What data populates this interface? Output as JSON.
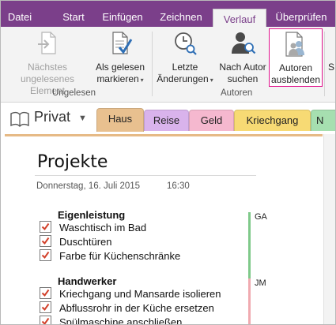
{
  "ribbon_tabs": [
    "Datei",
    "Start",
    "Einfügen",
    "Zeichnen",
    "Verlauf",
    "Überprüfen"
  ],
  "active_tab": "Verlauf",
  "ribbon": {
    "next_unread": {
      "line1": "Nächstes",
      "line2": "ungelesenes Element"
    },
    "mark_read": {
      "line1": "Als gelesen",
      "line2": "markieren"
    },
    "recent_changes": {
      "line1": "Letzte",
      "line2": "Änderungen"
    },
    "find_by_author": {
      "line1": "Nach Autor",
      "line2": "suchen"
    },
    "hide_authors": {
      "line1": "Autoren",
      "line2": "ausblenden"
    },
    "overflow_label": "S",
    "group_unread": "Ungelesen",
    "group_authors": "Autoren"
  },
  "notebook": {
    "name": "Privat",
    "sections": [
      "Haus",
      "Reise",
      "Geld",
      "Kriechgang",
      "N"
    ],
    "active_section": "Haus"
  },
  "colors": {
    "ribbon_accent": "#7b3f8a",
    "highlight": "#e0128c",
    "section_haus": "#e8c08f",
    "section_reise": "#d9b3ec",
    "section_geld": "#f5b8cf",
    "section_kriechgang": "#f7da74",
    "section_n": "#a6dfb0",
    "author_ga": "#7fc98a",
    "author_jm": "#f0aab0"
  },
  "page": {
    "title": "Projekte",
    "date": "Donnerstag, 16. Juli 2015",
    "time": "16:30",
    "groups": [
      {
        "heading": "Eigenleistung",
        "author": "GA",
        "items": [
          "Waschtisch im Bad",
          "Duschtüren",
          "Farbe für Küchenschränke"
        ]
      },
      {
        "heading": "Handwerker",
        "author": "JM",
        "items": [
          "Kriechgang und Mansarde isolieren",
          "Abflussrohr in der Küche ersetzen",
          "Spülmaschine anschließen"
        ]
      }
    ]
  }
}
